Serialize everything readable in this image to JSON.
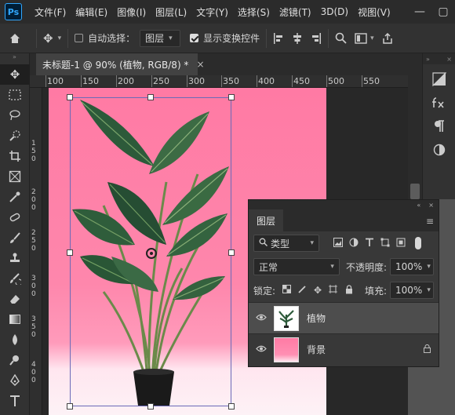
{
  "app": {
    "logo": "Ps"
  },
  "menu": [
    "文件(F)",
    "编辑(E)",
    "图像(I)",
    "图层(L)",
    "文字(Y)",
    "选择(S)",
    "滤镜(T)",
    "3D(D)",
    "视图(V)"
  ],
  "window_controls": {
    "minimize": "—",
    "restore": "▢",
    "close": "✕"
  },
  "options_bar": {
    "auto_select_label": "自动选择：",
    "auto_select_checked": false,
    "auto_select_target": "图层",
    "show_transform_label": "显示变换控件",
    "show_transform_checked": true
  },
  "document_tab": {
    "title": "未标题-1 @ 90% (植物, RGB/8) *",
    "close": "×"
  },
  "toolbar_collapse": "»",
  "ruler_top_labels": [
    "100",
    "150",
    "200",
    "250",
    "300",
    "350",
    "400",
    "450",
    "500",
    "550"
  ],
  "ruler_left_labels": [
    "1",
    "5",
    "0",
    "2",
    "0",
    "0",
    "2",
    "5",
    "0",
    "3",
    "0",
    "0",
    "3",
    "5",
    "0",
    "4",
    "0",
    "0"
  ],
  "mini_panel": {
    "collapse": "»",
    "close": "×",
    "icons": [
      "adjust-icon",
      "fx-icon",
      "paragraph-icon",
      "styles-icon"
    ]
  },
  "layers_panel": {
    "collapse": "«",
    "close": "×",
    "tab": "图层",
    "menu_icon": "≡",
    "filter_kind": "类型",
    "blend_mode": "正常",
    "opacity_label": "不透明度:",
    "opacity_value": "100%",
    "lock_label": "锁定:",
    "fill_label": "填充:",
    "fill_value": "100%",
    "layers": [
      {
        "name": "植物",
        "visible": true,
        "selected": true,
        "locked": false
      },
      {
        "name": "背景",
        "visible": true,
        "selected": false,
        "locked": true
      }
    ]
  },
  "colors": {
    "canvas_pink": "#fe87ac",
    "canvas_floor": "#fdf2f6",
    "selection_box": "#6a6ab8",
    "accent_blue": "#31a8ff"
  }
}
